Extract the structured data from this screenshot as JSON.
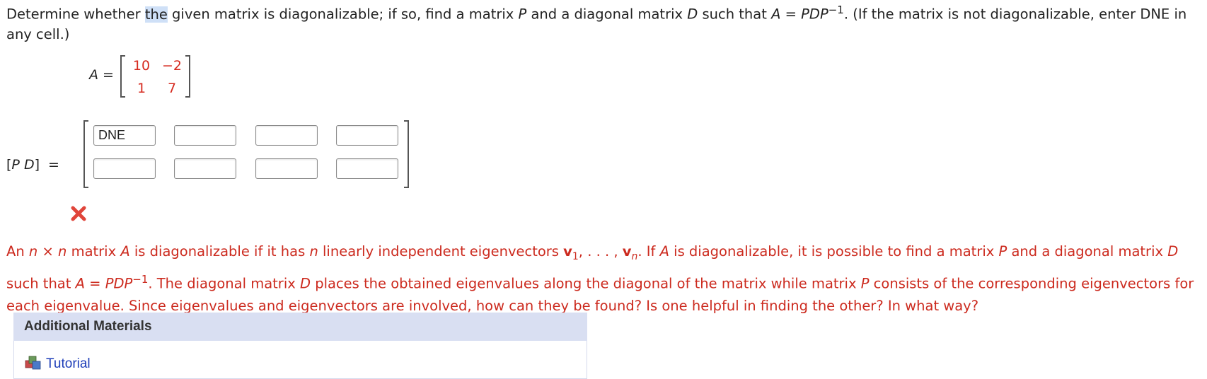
{
  "question": {
    "p1": "Determine whether ",
    "highlight": "the",
    "p2": " given matrix is diagonalizable; if so, find a matrix ",
    "P": "P",
    "p3": " and a diagonal matrix ",
    "D": "D",
    "p4": " such that ",
    "A": "A",
    "eq": " = ",
    "PDP": "PDP",
    "sup": "−1",
    "p5": ". (If the matrix is not diagonalizable, enter DNE in any cell.)"
  },
  "matrix_a": {
    "label": "A",
    "eq": " =",
    "cells": [
      "10",
      "−2",
      "1",
      "7"
    ]
  },
  "pd": {
    "label_open": "[",
    "label_P": "P",
    "label_D": "D",
    "label_close": "]",
    "eq": " =",
    "inputs": [
      "DNE",
      "",
      "",
      "",
      "",
      "",
      "",
      ""
    ]
  },
  "hint": {
    "t1": "An ",
    "n1": "n",
    "t2": " × ",
    "n2": "n",
    "t3": " matrix ",
    "A1": "A",
    "t4": " is diagonalizable if it has ",
    "n3": "n",
    "t5": " linearly independent eigenvectors ",
    "v1": "v",
    "sub1": "1",
    "t6": ", . . . , ",
    "vn": "v",
    "subn": "n",
    "t7": ". If ",
    "A2": "A",
    "t8": " is diagonalizable, it is possible to find a matrix ",
    "P1": "P",
    "t9": " and a diagonal matrix ",
    "D1": "D",
    "t10": " such that ",
    "A3": "A",
    "t11": " = ",
    "PDP": "PDP",
    "sup": "−1",
    "t12": ". The diagonal matrix ",
    "D2": "D",
    "t13": " places the obtained eigenvalues along the diagonal of the matrix while matrix ",
    "P2": "P",
    "t14": " consists of the corresponding eigenvectors for each eigenvalue. Since eigenvalues and eigenvectors are involved, how can they be found? Is one helpful in finding the other? In what way?"
  },
  "additional": {
    "title": "Additional Materials",
    "link": "Tutorial",
    "icon": "tutorial-icon"
  },
  "colors": {
    "error": "#cc2a1e",
    "panel_header": "#d9dff2",
    "link": "#1d3db8",
    "highlight": "#cfe0f7"
  }
}
